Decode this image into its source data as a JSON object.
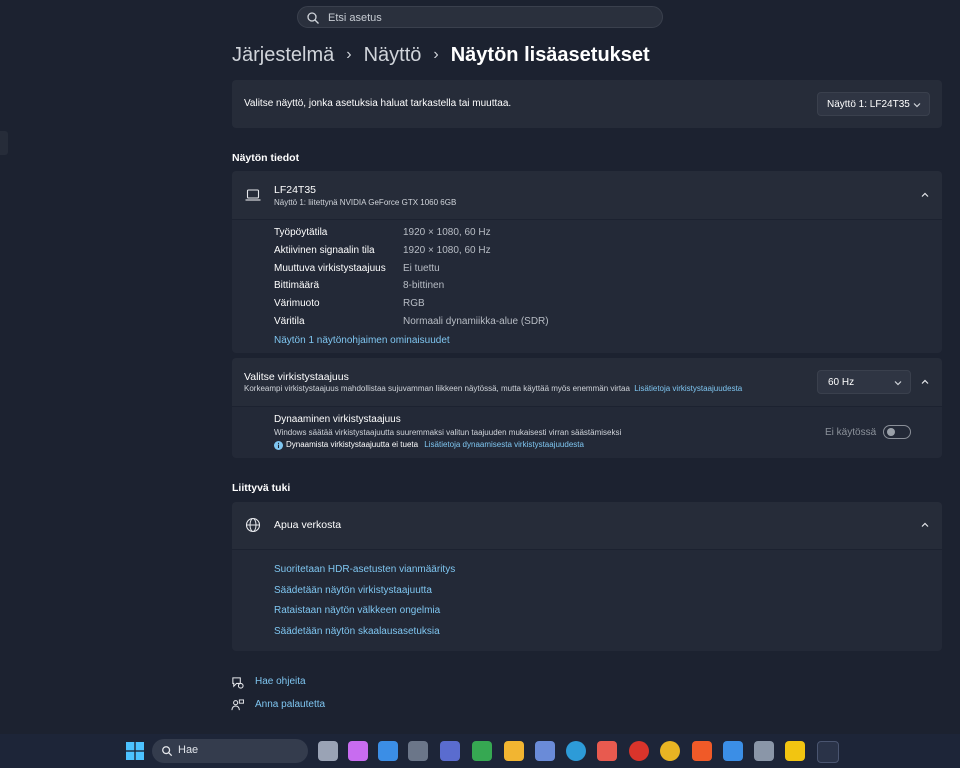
{
  "search": {
    "placeholder": "Etsi asetus"
  },
  "breadcrumb": {
    "item1": "Järjestelmä",
    "sep": "›",
    "item2": "Näyttö",
    "current": "Näytön lisäasetukset"
  },
  "select_display": {
    "prompt": "Valitse näyttö, jonka asetuksia haluat tarkastella tai muuttaa.",
    "value": "Näyttö 1: LF24T35"
  },
  "display_info": {
    "section_title": "Näytön tiedot",
    "monitor_name": "LF24T35",
    "monitor_sub": "Näyttö 1: liitettynä NVIDIA GeForce GTX 1060 6GB",
    "rows": [
      {
        "label": "Työpöytätila",
        "value": "1920 × 1080, 60 Hz"
      },
      {
        "label": "Aktiivinen signaalin tila",
        "value": "1920 × 1080, 60 Hz"
      },
      {
        "label": "Muuttuva virkistystaajuus",
        "value": "Ei tuettu"
      },
      {
        "label": "Bittimäärä",
        "value": "8-bittinen"
      },
      {
        "label": "Värimuoto",
        "value": "RGB"
      },
      {
        "label": "Väritila",
        "value": "Normaali dynamiikka-alue (SDR)"
      }
    ],
    "adapter_link": "Näytön 1 näytönohjaimen ominaisuudet"
  },
  "refresh": {
    "title": "Valitse virkistystaajuus",
    "desc": "Korkeampi virkistystaajuus mahdollistaa sujuvamman liikkeen näytössä, mutta käyttää myös enemmän virtaa",
    "link": "Lisätietoja virkistystaajuudesta",
    "value": "60 Hz"
  },
  "dynamic": {
    "title": "Dynaaminen virkistystaajuus",
    "desc": "Windows säätää virkistystaajuutta suuremmaksi valitun taajuuden mukaisesti virran säästämiseksi",
    "info": "Dynaamista virkistystaajuutta ei tueta",
    "link": "Lisätietoja dynaamisesta virkistystaajuudesta",
    "toggle_label": "Ei käytössä"
  },
  "support": {
    "section_title": "Liittyvä tuki",
    "card_title": "Apua verkosta",
    "links": [
      "Suoritetaan HDR-asetusten vianmääritys",
      "Säädetään näytön virkistystaajuutta",
      "Rataistaan näytön välkkeen ongelmia",
      "Säädetään näytön skaalausasetuksia"
    ]
  },
  "footer": {
    "help": "Hae ohjeita",
    "feedback": "Anna palautetta"
  },
  "taskbar": {
    "search": "Hae",
    "icons": [
      "windows-start-icon",
      "task-view-icon",
      "copilot-icon",
      "mail-icon",
      "tool-icon",
      "app-icon",
      "xbox-icon",
      "file-explorer-icon",
      "store-icon",
      "edge-icon",
      "snipping-icon",
      "opera-icon",
      "chrome-icon",
      "brave-icon",
      "notepad-icon",
      "calculator-icon",
      "sticky-notes-icon",
      "settings-icon"
    ]
  },
  "colors": {
    "background": "#1c2230",
    "card": "#262c39",
    "accent_link": "#7fc6f1",
    "taskbar": "#1d2538"
  }
}
